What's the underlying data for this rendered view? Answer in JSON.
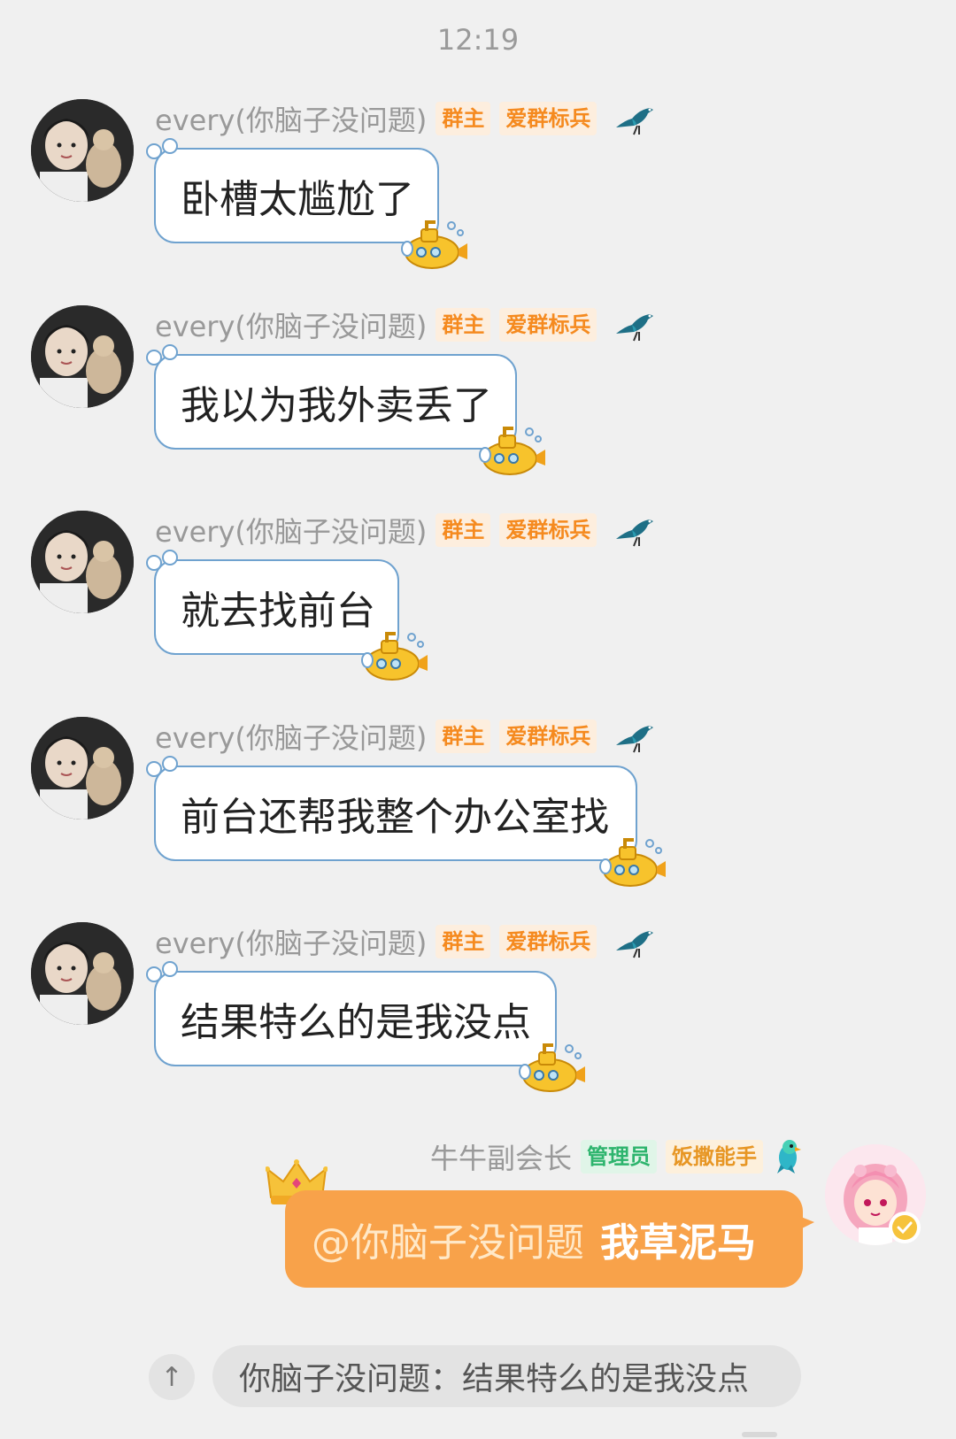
{
  "status": {
    "time": "12:19"
  },
  "messages": [
    {
      "sender": "every(你脑子没问题)",
      "tags": [
        "群主",
        "爱群标兵"
      ],
      "text": "卧槽太尴尬了"
    },
    {
      "sender": "every(你脑子没问题)",
      "tags": [
        "群主",
        "爱群标兵"
      ],
      "text": "我以为我外卖丢了"
    },
    {
      "sender": "every(你脑子没问题)",
      "tags": [
        "群主",
        "爱群标兵"
      ],
      "text": "就去找前台"
    },
    {
      "sender": "every(你脑子没问题)",
      "tags": [
        "群主",
        "爱群标兵"
      ],
      "text": "前台还帮我整个办公室找"
    },
    {
      "sender": "every(你脑子没问题)",
      "tags": [
        "群主",
        "爱群标兵"
      ],
      "text": "结果特么的是我没点"
    }
  ],
  "outgoing": {
    "sender": "牛牛副会长",
    "tags": [
      "管理员",
      "饭撒能手"
    ],
    "mention": "@你脑子没问题",
    "text": "我草泥马"
  },
  "quote": {
    "text": "你脑子没问题：结果特么的是我没点",
    "scroll_icon": "↑"
  },
  "icons": {
    "incoming_badge": "bird-icon",
    "bubble_decoration": "submarine-icon",
    "outgoing_badge": "parrot-icon",
    "outgoing_decoration": "crown-icon",
    "verified": "verified-check-icon"
  },
  "colors": {
    "background": "#f0f0f0",
    "bubble_border": "#6fa2cf",
    "outgoing_bubble": "#f8a24a",
    "tag_orange": "#f58a1f",
    "tag_green": "#2db46d"
  }
}
